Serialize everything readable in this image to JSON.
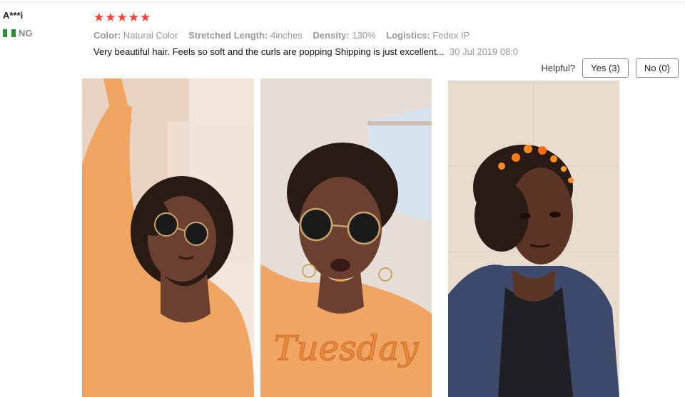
{
  "reviewer": {
    "name": "A***i",
    "country": "NG"
  },
  "review": {
    "stars": "★★★★★",
    "rating": 5,
    "attributes": [
      {
        "label": "Color:",
        "value": "Natural Color"
      },
      {
        "label": "Stretched Length:",
        "value": "4inches"
      },
      {
        "label": "Density:",
        "value": "130%"
      },
      {
        "label": "Logistics:",
        "value": "Fedex IP"
      }
    ],
    "text": "Very beautiful hair. Feels so soft and the curls are popping Shipping is just excellent...",
    "date": "30 Jul 2019 08:0"
  },
  "helpful": {
    "label": "Helpful?",
    "yes": "Yes (3)",
    "no": "No (0)"
  },
  "photos": [
    {
      "sweater_text": ""
    },
    {
      "sweater_text": "Tuesday"
    },
    {
      "sweater_text": ""
    }
  ],
  "colors": {
    "star": "#f44336",
    "sweater": "#f0a563",
    "hair": "#2a1a14",
    "skin": "#6b4030",
    "hoodie": "#3e4a6b"
  }
}
